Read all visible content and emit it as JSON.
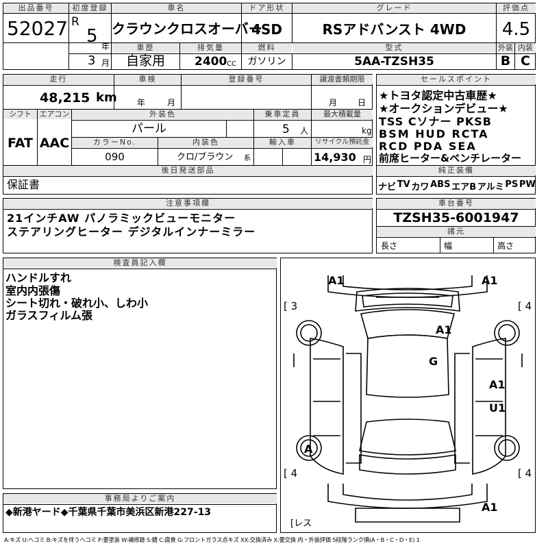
{
  "header": {
    "lot_label": "出品番号",
    "lot_value": "52027",
    "first_reg_label": "初度登録",
    "era_letter": "R",
    "year_value": "5",
    "year_unit": "年",
    "month_value": "3",
    "month_unit": "月",
    "model_label": "車名",
    "model_value": "クラウンクロスオーバー",
    "door_label": "ドア形状",
    "door_value": "4SD",
    "grade_label": "グレード",
    "grade_value": "RSアドバンスト 4WD",
    "score_label": "評価点",
    "score_value": "4.5",
    "history_label": "車歴",
    "history_value": "自家用",
    "disp_label": "排気量",
    "disp_value": "2400",
    "disp_unit": "CC",
    "fuel_label": "燃料",
    "fuel_value": "ガソリン",
    "type_label": "型式",
    "type_value": "5AA-TZSH35",
    "ext_label": "外装",
    "ext_value": "B",
    "int_label": "内装",
    "int_value": "C"
  },
  "specs": {
    "mileage_label": "走行",
    "mileage_value": "48,215",
    "mileage_unit": "km",
    "inspection_label": "車検",
    "insp_year": "年",
    "insp_month": "月",
    "reg_no_label": "登録番号",
    "transfer_label": "譲渡書類期限",
    "transfer_month": "月",
    "transfer_day": "日",
    "shift_label": "シフト",
    "shift_value": "FAT",
    "ac_label": "エアコン",
    "ac_value": "AAC",
    "color_label": "外装色",
    "color_value": "パール",
    "capacity_label": "乗車定員",
    "capacity_value": "5",
    "capacity_unit": "人",
    "load_label": "最大積載量",
    "load_unit": "kg",
    "color_no_label": "カラーNo.",
    "color_no_value": "090",
    "int_color_label": "内装色",
    "int_color_value": "クロ/ブラウン",
    "int_color_unit": "系",
    "import_label": "輸入車",
    "recycle_label": "リサイクル預託金",
    "recycle_value": "14,930",
    "recycle_unit": "円",
    "later_label": "後日発送部品",
    "later_value": "保証書"
  },
  "selling_points": {
    "label": "セールスポイント",
    "lines": [
      "★トヨタ認定中古車歴★",
      "★オークションデビュー★",
      "TSS Cソナー PKSB",
      "BSM HUD RCTA",
      "RCD PDA SEA",
      "前席ヒーター&ベンチレーター"
    ]
  },
  "equipment": {
    "label": "純正装備",
    "items": [
      "ナビ",
      "TV",
      "カワ",
      "ABS",
      "エアB",
      "アルミ",
      "PS",
      "PW"
    ]
  },
  "notes": {
    "label": "注意事項欄",
    "lines": [
      "21インチAW パノラミックビューモニター",
      "ステアリングヒーター デジタルインナーミラー"
    ]
  },
  "chassis": {
    "label": "車台番号",
    "value": "TZSH35-6001947",
    "dims_label": "諸元",
    "length": "長さ",
    "width": "幅",
    "height": "高さ"
  },
  "inspector": {
    "label": "検査員記入欄",
    "lines": [
      "ハンドルすれ",
      "室内内張傷",
      "シート切れ・破れ小、しわ小",
      "ガラスフィルム張"
    ]
  },
  "diagram": {
    "marks": {
      "fl": "A1",
      "fr": "A1",
      "hood": "A1",
      "roof": "G",
      "rdoor": "A1",
      "rquarter": "U1",
      "lwheel": "A",
      "rear": "A1"
    },
    "tires": {
      "fl": "3",
      "fr": "4",
      "rl": "4",
      "rr": "4",
      "spare": "レス"
    }
  },
  "office": {
    "label": "事務局よりご案内",
    "value": "◆新港ヤード◆千葉県千葉市美浜区新港227-13"
  },
  "legend": "A:キズ U:ヘコミ B:キズを伴うヘコミ P:要塗装 W:補修跡 S:錆 C:腐食 G:フロントガラス点キズ XX:交換済み X:要交換 内・外装評価 5段階ランク順(A・B・C・D・E) 1"
}
